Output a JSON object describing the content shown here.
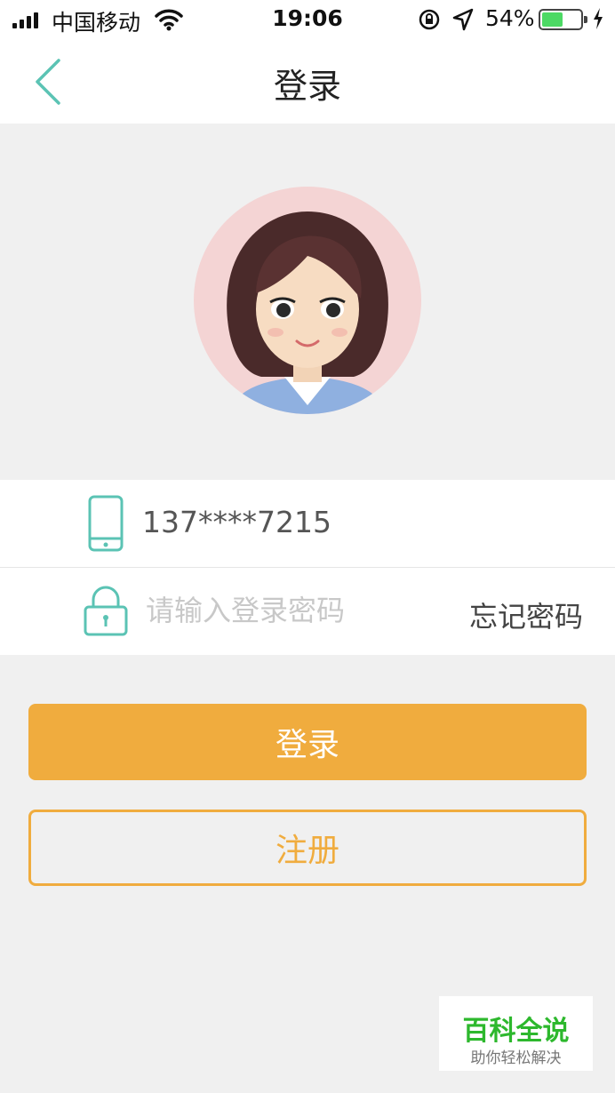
{
  "status_bar": {
    "carrier": "中国移动",
    "time": "19:06",
    "battery_percent": "54%",
    "battery_level": 0.54
  },
  "nav": {
    "title": "登录",
    "back_icon": "chevron-left-icon"
  },
  "form": {
    "phone_value": "137****7215",
    "password_placeholder": "请输入登录密码",
    "forgot_password": "忘记密码"
  },
  "buttons": {
    "login": "登录",
    "register": "注册"
  },
  "watermark": {
    "title": "百科全说",
    "subtitle": "助你轻松解决"
  },
  "colors": {
    "accent": "#f0ac3e",
    "icon_teal": "#5bc3b4",
    "avatar_bg": "#f4d4d4"
  }
}
